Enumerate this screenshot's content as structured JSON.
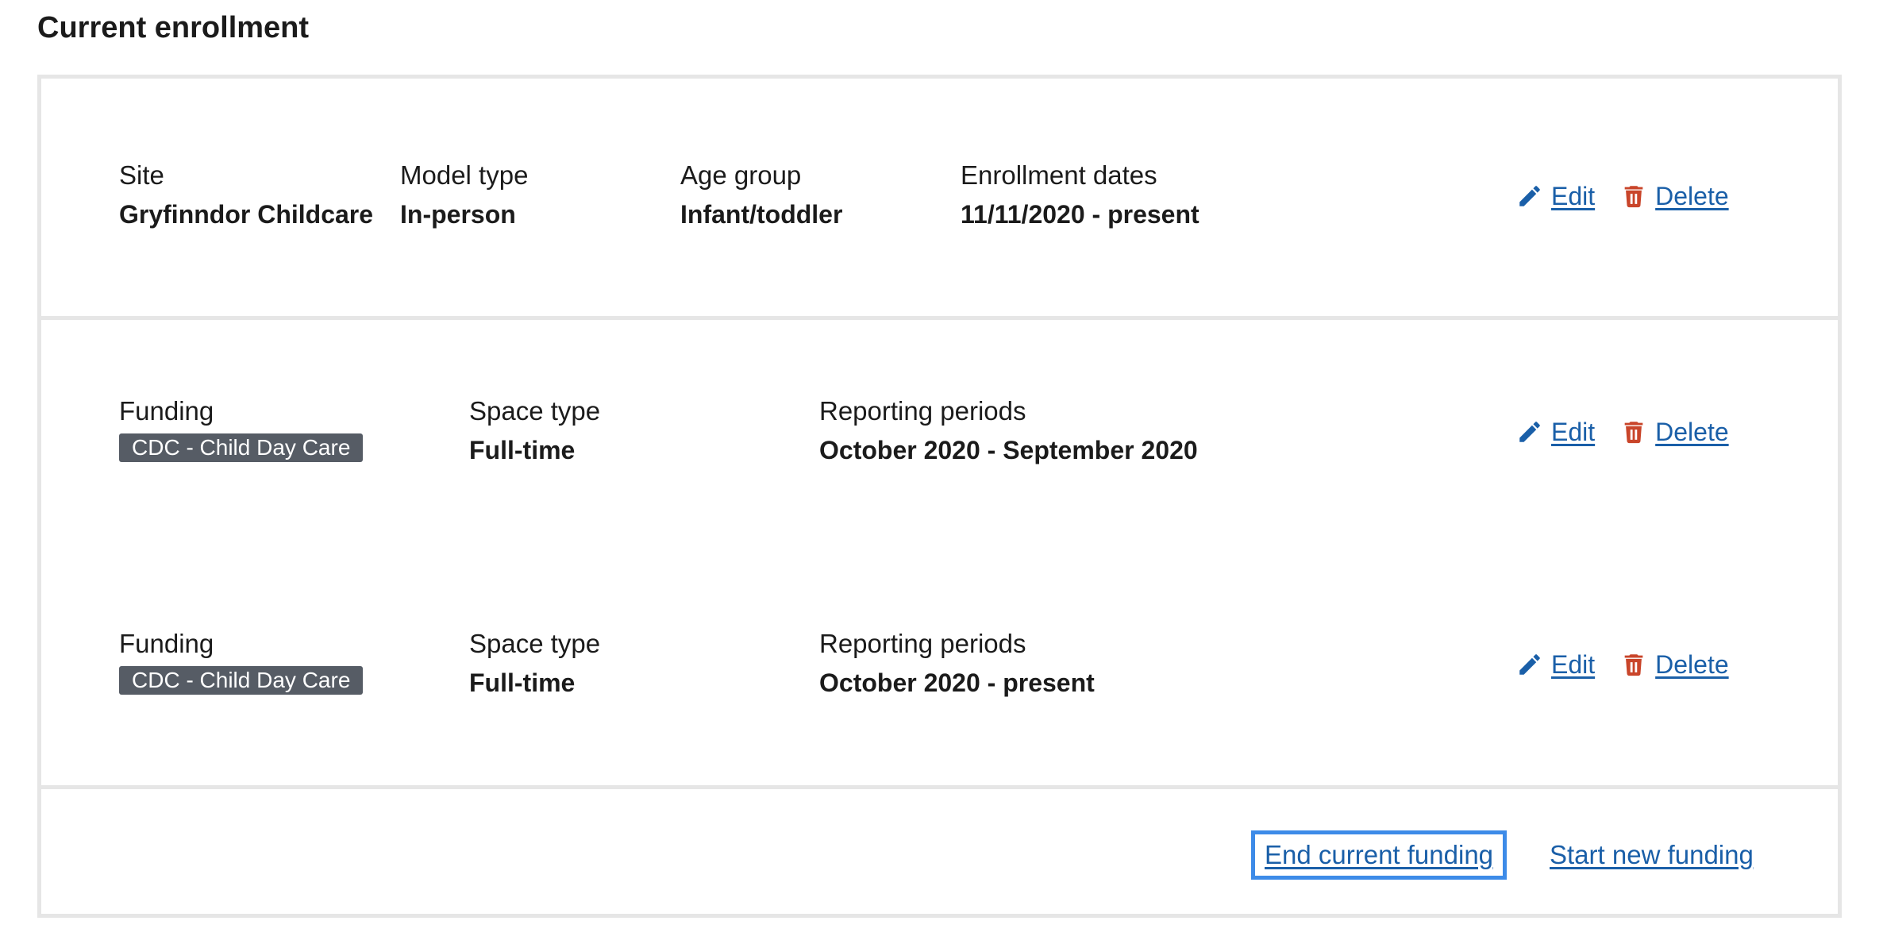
{
  "title": "Current enrollment",
  "enrollment": {
    "site_label": "Site",
    "site_value": "Gryfinndor Childcare",
    "model_label": "Model type",
    "model_value": "In-person",
    "age_label": "Age group",
    "age_value": "Infant/toddler",
    "dates_label": "Enrollment dates",
    "dates_value": "11/11/2020 - present",
    "edit_label": "Edit",
    "delete_label": "Delete"
  },
  "fundings": [
    {
      "funding_label": "Funding",
      "funding_tag": "CDC - Child Day Care",
      "space_label": "Space type",
      "space_value": "Full-time",
      "periods_label": "Reporting periods",
      "periods_value": "October 2020 - September 2020",
      "edit_label": "Edit",
      "delete_label": "Delete"
    },
    {
      "funding_label": "Funding",
      "funding_tag": "CDC - Child Day Care",
      "space_label": "Space type",
      "space_value": "Full-time",
      "periods_label": "Reporting periods",
      "periods_value": "October 2020 - present",
      "edit_label": "Edit",
      "delete_label": "Delete"
    }
  ],
  "actions": {
    "end_funding": "End current funding",
    "start_funding": "Start new funding"
  },
  "colors": {
    "link": "#1a5fa8",
    "delete_icon": "#c9452a",
    "tag_bg": "#565c65",
    "focus_ring": "#3d8be8",
    "border": "#e6e6e6"
  },
  "icons": {
    "edit": "pencil-icon",
    "delete": "trash-icon"
  }
}
